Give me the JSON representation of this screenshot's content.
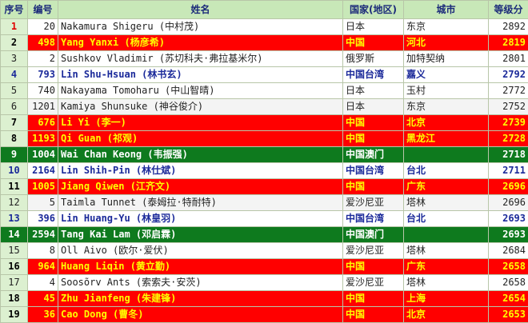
{
  "headers": {
    "idx": "序号",
    "num": "编号",
    "name": "姓名",
    "country": "国家(地区)",
    "city": "城市",
    "elo": "等级分"
  },
  "rows": [
    {
      "idx": "1",
      "num": "20",
      "name": "Nakamura Shigeru (中村茂)",
      "country": "日本",
      "city": "东京",
      "elo": "2892",
      "style": "first"
    },
    {
      "idx": "2",
      "num": "498",
      "name": "Yang Yanxi (杨彦希)",
      "country": "中国",
      "city": "河北",
      "elo": "2819",
      "style": "red"
    },
    {
      "idx": "3",
      "num": "2",
      "name": "Sushkov Vladimir (苏切科夫·弗拉基米尔)",
      "country": "俄罗斯",
      "city": "加特契纳",
      "elo": "2801",
      "style": "plain"
    },
    {
      "idx": "4",
      "num": "793",
      "name": "Lin Shu-Hsuan (林书玄)",
      "country": "中国台湾",
      "city": "嘉义",
      "elo": "2792",
      "style": "blue"
    },
    {
      "idx": "5",
      "num": "740",
      "name": "Nakayama Tomoharu (中山智晴)",
      "country": "日本",
      "city": "玉村",
      "elo": "2772",
      "style": "plain"
    },
    {
      "idx": "6",
      "num": "1201",
      "name": "Kamiya Shunsuke (神谷俊介)",
      "country": "日本",
      "city": "东京",
      "elo": "2752",
      "style": "plain"
    },
    {
      "idx": "7",
      "num": "676",
      "name": "Li Yi (李一)",
      "country": "中国",
      "city": "北京",
      "elo": "2739",
      "style": "red"
    },
    {
      "idx": "8",
      "num": "1193",
      "name": "Qi Guan (祁观)",
      "country": "中国",
      "city": "黑龙江",
      "elo": "2728",
      "style": "red"
    },
    {
      "idx": "9",
      "num": "1004",
      "name": "Wai Chan Keong (韦振强)",
      "country": "中国澳门",
      "city": "",
      "elo": "2718",
      "style": "green"
    },
    {
      "idx": "10",
      "num": "2164",
      "name": "Lin Shih-Pin (林仕斌)",
      "country": "中国台湾",
      "city": "台北",
      "elo": "2711",
      "style": "blue"
    },
    {
      "idx": "11",
      "num": "1005",
      "name": "Jiang Qiwen (江齐文)",
      "country": "中国",
      "city": "广东",
      "elo": "2696",
      "style": "red"
    },
    {
      "idx": "12",
      "num": "5",
      "name": "Taimla Tunnet (泰姆拉·特耐特)",
      "country": "爱沙尼亚",
      "city": "塔林",
      "elo": "2696",
      "style": "plain"
    },
    {
      "idx": "13",
      "num": "396",
      "name": "Lin Huang-Yu (林皇羽)",
      "country": "中国台湾",
      "city": "台北",
      "elo": "2693",
      "style": "blue"
    },
    {
      "idx": "14",
      "num": "2594",
      "name": "Tang Kai Lam (邓启霖)",
      "country": "中国澳门",
      "city": "",
      "elo": "2693",
      "style": "green"
    },
    {
      "idx": "15",
      "num": "8",
      "name": "Oll Aivo (欧尔·爱伏)",
      "country": "爱沙尼亚",
      "city": "塔林",
      "elo": "2684",
      "style": "plain"
    },
    {
      "idx": "16",
      "num": "964",
      "name": "Huang Liqin (黄立勤)",
      "country": "中国",
      "city": "广东",
      "elo": "2658",
      "style": "red"
    },
    {
      "idx": "17",
      "num": "4",
      "name": "Soosõrv Ants (索索夫·安茨)",
      "country": "爱沙尼亚",
      "city": "塔林",
      "elo": "2658",
      "style": "plain"
    },
    {
      "idx": "18",
      "num": "45",
      "name": "Zhu Jianfeng (朱建锋)",
      "country": "中国",
      "city": "上海",
      "elo": "2654",
      "style": "red"
    },
    {
      "idx": "19",
      "num": "36",
      "name": "Cao Dong (曹冬)",
      "country": "中国",
      "city": "北京",
      "elo": "2653",
      "style": "red"
    }
  ]
}
